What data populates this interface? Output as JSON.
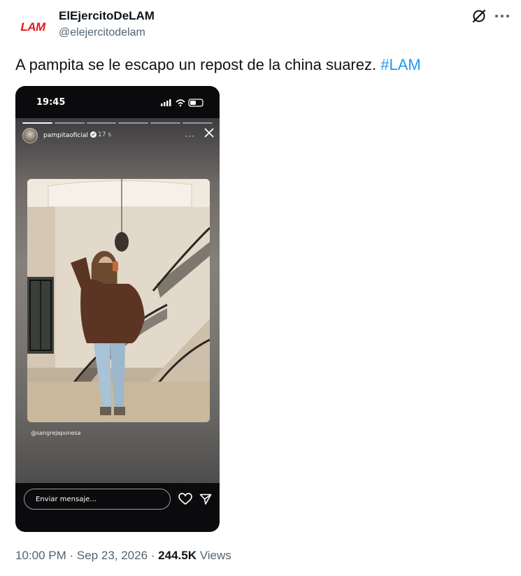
{
  "author": {
    "avatar_text": "LAM",
    "display_name": "ElEjercitoDeLAM",
    "handle": "@elejercitodelam"
  },
  "tweet": {
    "text": "A pampita se le escapo un repost de la china suarez.",
    "hashtag": "#LAM",
    "time": "10:00 PM",
    "date": "Sep 23, 2026",
    "views_count": "244.5K",
    "views_label": "Views"
  },
  "story_screenshot": {
    "status_time": "19:45",
    "username": "pampitaoficial",
    "age": "17 s",
    "more": "···",
    "repost_credit": "@sangrejaponesa",
    "message_placeholder": "Enviar mensaje..."
  },
  "icons": {
    "grok": "grok-icon",
    "more": "more-icon",
    "close": "close-icon",
    "heart": "heart-icon",
    "send": "send-icon"
  },
  "colors": {
    "link": "#1d9bf0",
    "brand": "#e3191b",
    "muted": "#536471"
  }
}
